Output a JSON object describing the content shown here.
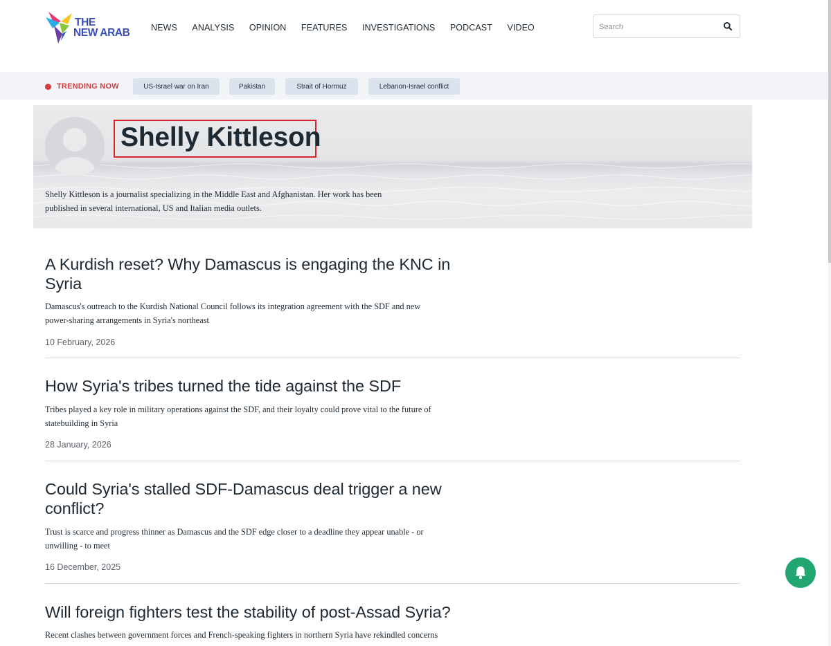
{
  "site": {
    "logo_line1": "THE",
    "logo_line2": "NEW ARAB"
  },
  "nav": {
    "items": [
      "NEWS",
      "ANALYSIS",
      "OPINION",
      "FEATURES",
      "INVESTIGATIONS",
      "PODCAST",
      "VIDEO"
    ]
  },
  "search": {
    "placeholder": "Search",
    "icon": "search-icon"
  },
  "trending": {
    "label": "TRENDING NOW",
    "dot_color": "#d23d3f",
    "topics": [
      "US-Israel war on Iran",
      "Pakistan",
      "Strait of Hormuz",
      "Lebanon-Israel conflict"
    ]
  },
  "author": {
    "name": "Shelly Kittleson",
    "bio_line1": "Shelly Kittleson is a journalist specializing in the Middle East and Afghanistan. Her work has been",
    "bio_line2": "published in several international, US and Italian media outlets."
  },
  "articles": [
    {
      "title": "A Kurdish reset? Why Damascus is engaging the KNC in Syria",
      "summary_line1": "Damascus's outreach to the Kurdish National Council follows its integration agreement with the SDF and new",
      "summary_line2": "power-sharing arrangements in Syria's northeast",
      "date": "10 February, 2026"
    },
    {
      "title": "How Syria's tribes turned the tide against the SDF",
      "summary_line1": "Tribes played a key role in military operations against the SDF, and their loyalty could prove vital to the future of",
      "summary_line2": "statebuilding in Syria",
      "date": "28 January, 2026"
    },
    {
      "title": "Could Syria's stalled SDF-Damascus deal trigger a new conflict?",
      "summary_line1": "Trust is scarce and progress thinner as Damascus and the SDF edge closer to a deadline they appear unable - or",
      "summary_line2": "unwilling - to meet",
      "date": "16 December, 2025"
    },
    {
      "title": "Will foreign fighters test the stability of post-Assad Syria?",
      "summary_line1": "Recent clashes between government forces and French-speaking fighters in northern Syria have rekindled concerns"
    }
  ],
  "colors": {
    "accent": "#3a4db8",
    "trending_red": "#d23d3f",
    "chip_bg": "#dbe3ee",
    "highlight_box": "#d8262d",
    "bell_green": "#21a671"
  },
  "notification": {
    "icon": "bell-icon",
    "close": "×"
  }
}
